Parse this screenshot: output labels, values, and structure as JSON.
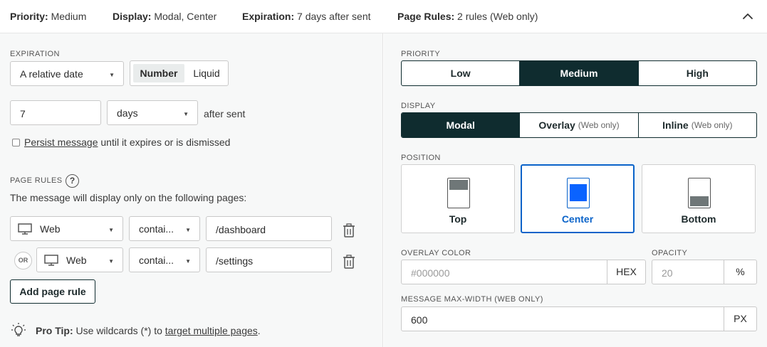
{
  "header": {
    "priority_label": "Priority:",
    "priority_value": "Medium",
    "display_label": "Display:",
    "display_value": "Modal, Center",
    "expiration_label": "Expiration:",
    "expiration_value": "7 days after sent",
    "page_rules_label": "Page Rules:",
    "page_rules_value": "2 rules (Web only)",
    "collapse_icon": "chevron-up-icon"
  },
  "expiration": {
    "section_label": "EXPIRATION",
    "type_select": "A relative date",
    "mode_options": [
      "Number",
      "Liquid"
    ],
    "mode_selected": "Number",
    "amount": "7",
    "unit_select": "days",
    "after_text": "after sent",
    "persist_checked": false,
    "persist_link": "Persist message",
    "persist_rest": "until it expires or is dismissed"
  },
  "page_rules": {
    "section_label": "PAGE RULES",
    "help_icon": "question-circle-icon",
    "description": "The message will display only on the following pages:",
    "or_label": "OR",
    "rules": [
      {
        "platform": "Web",
        "platform_icon": "monitor-icon",
        "operator": "contai...",
        "value": "/dashboard"
      },
      {
        "platform": "Web",
        "platform_icon": "monitor-icon",
        "operator": "contai...",
        "value": "/settings"
      }
    ],
    "add_button": "Add page rule"
  },
  "tip": {
    "icon": "lightbulb-icon",
    "bold": "Pro Tip:",
    "text": "Use wildcards (*) to",
    "link": "target multiple pages",
    "end": "."
  },
  "priority": {
    "section_label": "PRIORITY",
    "options": [
      "Low",
      "Medium",
      "High"
    ],
    "selected": "Medium"
  },
  "display": {
    "section_label": "DISPLAY",
    "options": [
      {
        "label": "Modal",
        "note": ""
      },
      {
        "label": "Overlay",
        "note": "(Web only)"
      },
      {
        "label": "Inline",
        "note": "(Web only)"
      }
    ],
    "selected": "Modal"
  },
  "position": {
    "section_label": "POSITION",
    "options": [
      "Top",
      "Center",
      "Bottom"
    ],
    "selected": "Center"
  },
  "overlay": {
    "color_label": "OVERLAY COLOR",
    "color_placeholder": "#000000",
    "color_suffix": "HEX",
    "opacity_label": "OPACITY",
    "opacity_placeholder": "20",
    "opacity_suffix": "%"
  },
  "max_width": {
    "label": "MESSAGE MAX-WIDTH (WEB ONLY)",
    "value": "600",
    "suffix": "PX"
  },
  "colors": {
    "dark_accent": "#0f2c2f",
    "selected_blue": "#0a63c9",
    "panel_bg": "#f7f8f8"
  }
}
